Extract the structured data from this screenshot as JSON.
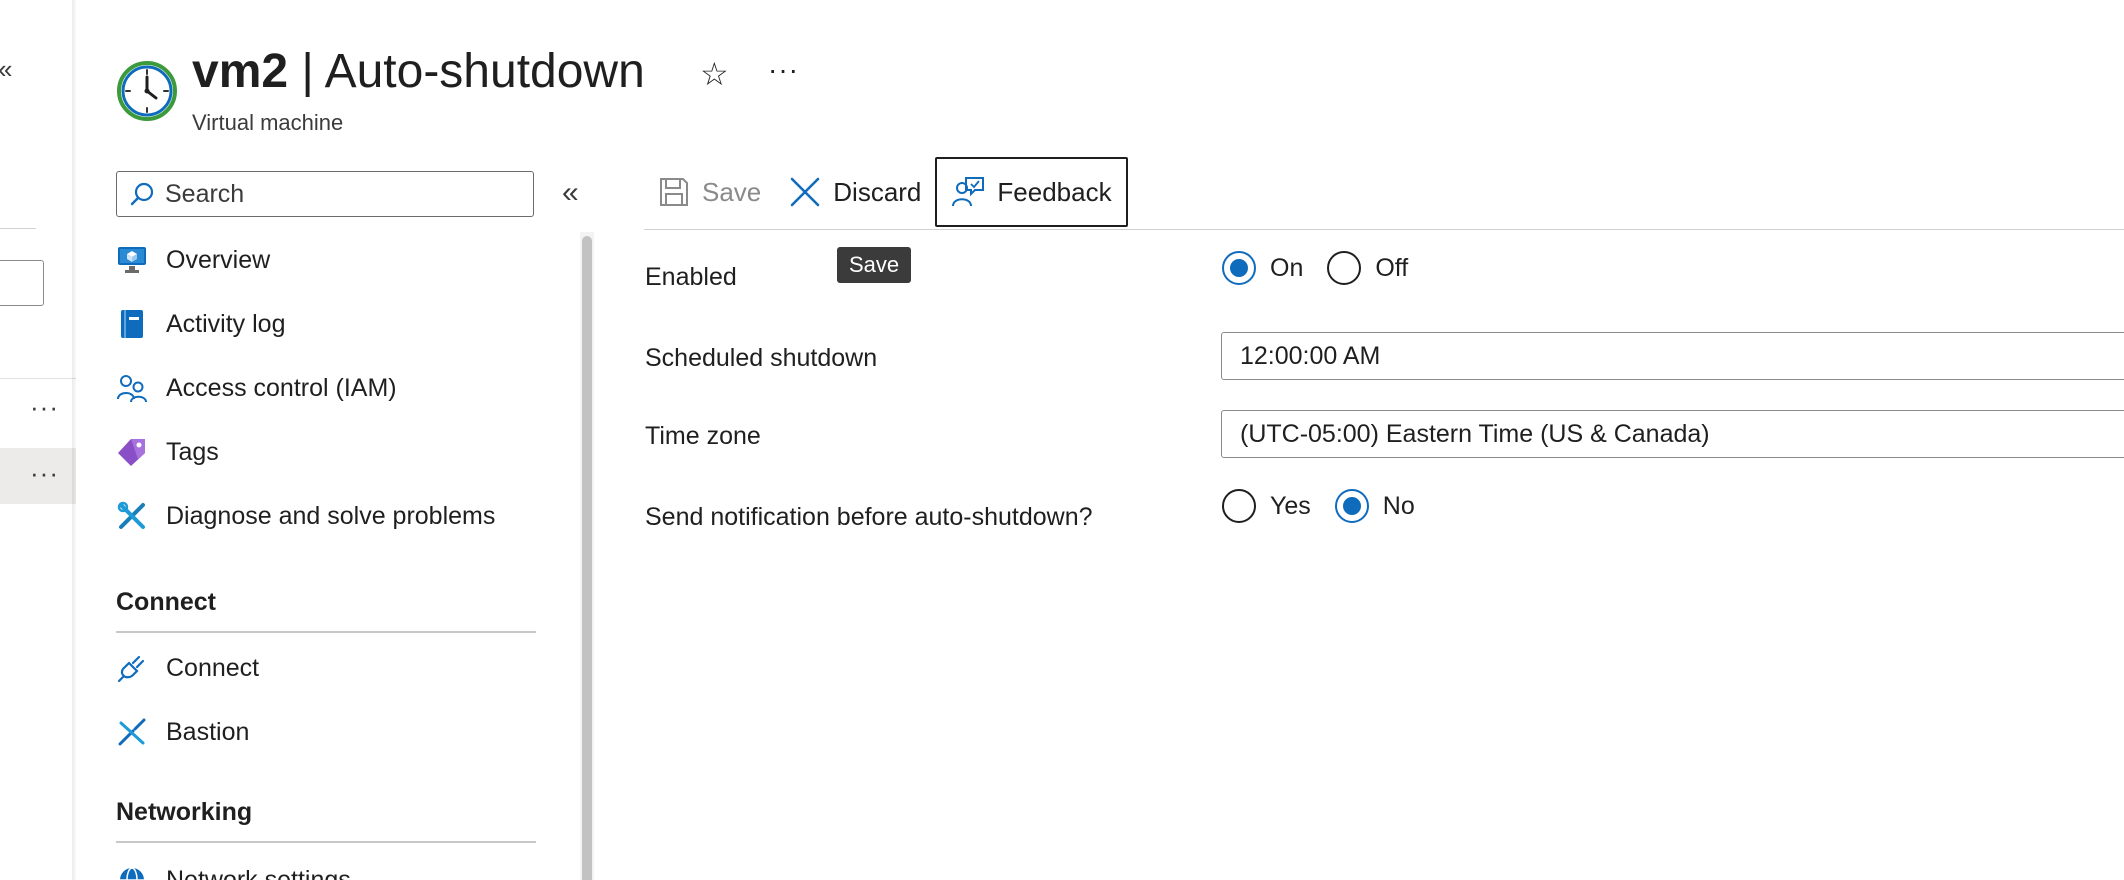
{
  "header": {
    "resource_name": "vm2",
    "separator": " | ",
    "page_name": "Auto-shutdown",
    "subtitle": "Virtual machine",
    "star_glyph": "☆",
    "more_glyph": "···"
  },
  "menu": {
    "search_placeholder": "Search",
    "collapse_glyph": "«",
    "items": [
      {
        "label": "Overview",
        "icon": "overview-monitor-icon"
      },
      {
        "label": "Activity log",
        "icon": "activity-log-book-icon"
      },
      {
        "label": "Access control (IAM)",
        "icon": "people-icon"
      },
      {
        "label": "Tags",
        "icon": "tag-icon"
      },
      {
        "label": "Diagnose and solve problems",
        "icon": "wrench-screwdriver-icon"
      }
    ],
    "sections": [
      {
        "title": "Connect",
        "items": [
          {
            "label": "Connect",
            "icon": "plug-icon"
          },
          {
            "label": "Bastion",
            "icon": "bastion-icon"
          }
        ]
      },
      {
        "title": "Networking",
        "items": [
          {
            "label": "Network settings",
            "icon": "globe-icon"
          }
        ]
      }
    ]
  },
  "toolbar": {
    "save_label": "Save",
    "discard_label": "Discard",
    "feedback_label": "Feedback"
  },
  "tooltip": {
    "text": "Save"
  },
  "form": {
    "enabled": {
      "label": "Enabled",
      "options": [
        "On",
        "Off"
      ],
      "selected": "On"
    },
    "scheduled_shutdown": {
      "label": "Scheduled shutdown",
      "value": "12:00:00 AM"
    },
    "time_zone": {
      "label": "Time zone",
      "value": "(UTC-05:00) Eastern Time (US & Canada)"
    },
    "notification": {
      "label": "Send notification before auto-shutdown?",
      "options": [
        "Yes",
        "No"
      ],
      "selected": "No"
    }
  },
  "background": {
    "collapse_glyph": "«",
    "row_more_glyph": "···"
  },
  "colors": {
    "accent": "#0f6cbd",
    "text": "#1f1f1f",
    "disabled": "#8a8a8a",
    "tooltip_bg": "#3b3b3b"
  }
}
